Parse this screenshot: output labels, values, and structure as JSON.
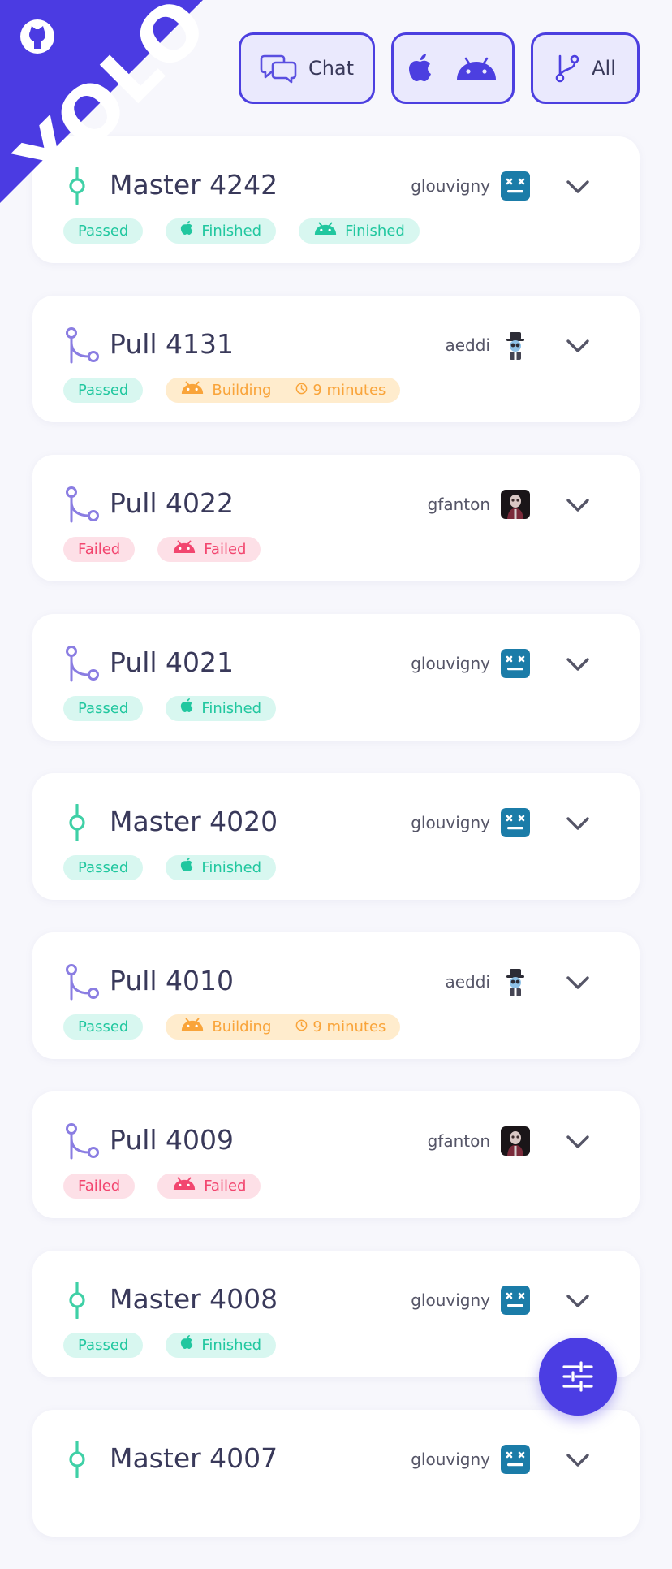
{
  "corner_banner": {
    "text": "YOLO",
    "icon": "github-icon",
    "color": "#4b3be2"
  },
  "header": {
    "chat_label": "Chat",
    "platform_icons": [
      "apple-icon",
      "android-icon"
    ],
    "filter_label": "All"
  },
  "colors": {
    "accent": "#4b3de3",
    "master_icon": "#3fd0a6",
    "pull_icon": "#8a7de2",
    "passed": "#21c79f",
    "failed": "#f2466f",
    "building": "#f9a43a"
  },
  "builds": [
    {
      "kind": "master",
      "title": "Master 4242",
      "author": "glouvigny",
      "avatar": "robot",
      "badges": [
        {
          "type": "ok",
          "icon": "",
          "label": "Passed"
        },
        {
          "type": "ok",
          "icon": "apple",
          "label": "Finished"
        },
        {
          "type": "ok",
          "icon": "android",
          "label": "Finished"
        }
      ]
    },
    {
      "kind": "pull",
      "title": "Pull 4131",
      "author": "aeddi",
      "avatar": "hat",
      "badges": [
        {
          "type": "ok",
          "icon": "",
          "label": "Passed"
        },
        {
          "type": "build",
          "icon": "android",
          "label": "Building",
          "duration": "9 minutes"
        }
      ]
    },
    {
      "kind": "pull",
      "title": "Pull 4022",
      "author": "gfanton",
      "avatar": "portrait",
      "badges": [
        {
          "type": "fail",
          "icon": "",
          "label": "Failed"
        },
        {
          "type": "fail",
          "icon": "android",
          "label": "Failed"
        }
      ]
    },
    {
      "kind": "pull",
      "title": "Pull 4021",
      "author": "glouvigny",
      "avatar": "robot",
      "badges": [
        {
          "type": "ok",
          "icon": "",
          "label": "Passed"
        },
        {
          "type": "ok",
          "icon": "apple",
          "label": "Finished"
        }
      ]
    },
    {
      "kind": "master",
      "title": "Master 4020",
      "author": "glouvigny",
      "avatar": "robot",
      "badges": [
        {
          "type": "ok",
          "icon": "",
          "label": "Passed"
        },
        {
          "type": "ok",
          "icon": "apple",
          "label": "Finished"
        }
      ]
    },
    {
      "kind": "pull",
      "title": "Pull 4010",
      "author": "aeddi",
      "avatar": "hat",
      "badges": [
        {
          "type": "ok",
          "icon": "",
          "label": "Passed"
        },
        {
          "type": "build",
          "icon": "android",
          "label": "Building",
          "duration": "9 minutes"
        }
      ]
    },
    {
      "kind": "pull",
      "title": "Pull 4009",
      "author": "gfanton",
      "avatar": "portrait",
      "badges": [
        {
          "type": "fail",
          "icon": "",
          "label": "Failed"
        },
        {
          "type": "fail",
          "icon": "android",
          "label": "Failed"
        }
      ]
    },
    {
      "kind": "master",
      "title": "Master 4008",
      "author": "glouvigny",
      "avatar": "robot",
      "badges": [
        {
          "type": "ok",
          "icon": "",
          "label": "Passed"
        },
        {
          "type": "ok",
          "icon": "apple",
          "label": "Finished"
        }
      ]
    },
    {
      "kind": "master",
      "title": "Master 4007",
      "author": "glouvigny",
      "avatar": "robot",
      "badges": []
    }
  ],
  "fab": {
    "icon": "sliders-icon"
  }
}
